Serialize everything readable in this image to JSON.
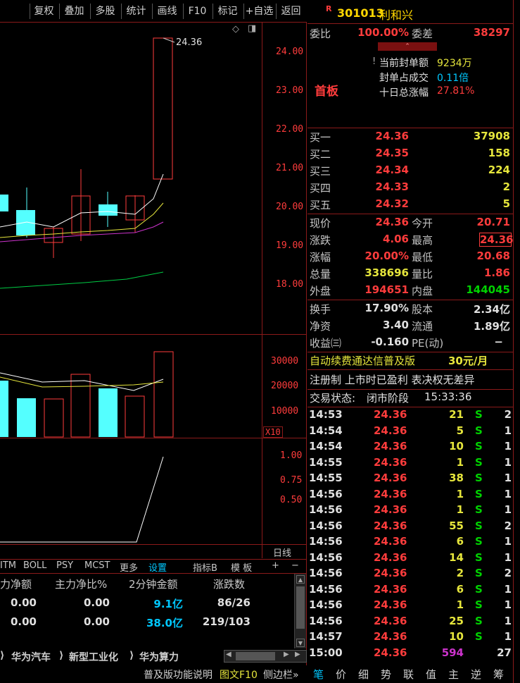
{
  "toolbar": {
    "buttons": [
      "复权",
      "叠加",
      "多股",
      "统计",
      "画线",
      "F10",
      "标记",
      "+自选",
      "返回"
    ]
  },
  "price_axis": [
    "24.00",
    "23.00",
    "22.00",
    "21.00",
    "20.00",
    "19.00",
    "18.00"
  ],
  "price_label": "24.36",
  "volume_axis": [
    "30000",
    "20000",
    "10000"
  ],
  "volume_unit": "X10",
  "osc_axis": [
    "1.00",
    "0.75",
    "0.50"
  ],
  "period_label": "日线",
  "indicator_tabs": [
    "ITM",
    "BOLL",
    "PSY",
    "MCST",
    "更多",
    "设置",
    "指标B",
    "模 板",
    "+",
    "−"
  ],
  "fund_flow": {
    "headers": [
      "力净额",
      "主力净比%",
      "2分钟金额",
      "涨跌数"
    ],
    "rows": [
      [
        "0.00",
        "0.00",
        "9.1亿",
        "86/26"
      ],
      [
        "0.00",
        "0.00",
        "38.0亿",
        "219/103"
      ]
    ]
  },
  "sector_tabs": [
    "华为汽车",
    "新型工业化",
    "华为算力"
  ],
  "status_bar": [
    "普及版功能说明",
    "图文F10",
    "侧边栏»"
  ],
  "stock": {
    "badge": "R",
    "code": "301013",
    "name": "利和兴"
  },
  "wei": {
    "ratio_label": "委比",
    "ratio": "100.00%",
    "diff_label": "委差",
    "diff": "38297"
  },
  "board": {
    "tag": "首板",
    "seal_amount_label": "当前封单额",
    "seal_amount": "9234万",
    "seal_ratio_label": "封单占成交",
    "seal_ratio": "0.11倍",
    "ten_day_label": "十日总涨幅",
    "ten_day": "27.81%"
  },
  "bids": [
    {
      "label": "买一",
      "price": "24.36",
      "vol": "37908"
    },
    {
      "label": "买二",
      "price": "24.35",
      "vol": "158"
    },
    {
      "label": "买三",
      "price": "24.34",
      "vol": "224"
    },
    {
      "label": "买四",
      "price": "24.33",
      "vol": "2"
    },
    {
      "label": "买五",
      "price": "24.32",
      "vol": "5"
    }
  ],
  "quote": {
    "now_label": "现价",
    "now": "24.36",
    "open_label": "今开",
    "open": "20.71",
    "chg_label": "涨跌",
    "chg": "4.06",
    "high_label": "最高",
    "high": "24.36",
    "pct_label": "涨幅",
    "pct": "20.00%",
    "low_label": "最低",
    "low": "20.68",
    "vol_label": "总量",
    "vol": "338696",
    "lb_label": "量比",
    "lb": "1.86",
    "out_label": "外盘",
    "out": "194651",
    "in_label": "内盘",
    "in": "144045"
  },
  "fundamental": {
    "turn_label": "换手",
    "turn": "17.90%",
    "cap_label": "股本",
    "cap": "2.34亿",
    "nav_label": "净资",
    "nav": "3.40",
    "float_label": "流通",
    "float": "1.89亿",
    "eps_label": "收益㈢",
    "eps": "-0.160",
    "pe_label": "PE(动)",
    "pe": "−"
  },
  "promo": {
    "text": "自动续费通达信普及版",
    "price": "30元/月"
  },
  "tags_line": "注册制 上市时已盈利 表决权无差异",
  "trade_state": {
    "label": "交易状态:",
    "state": "闭市阶段",
    "time": "15:33:36"
  },
  "ticks": [
    {
      "t": "14:53",
      "p": "24.36",
      "v": "21",
      "s": "S",
      "n": "2"
    },
    {
      "t": "14:54",
      "p": "24.36",
      "v": "5",
      "s": "S",
      "n": "1"
    },
    {
      "t": "14:54",
      "p": "24.36",
      "v": "10",
      "s": "S",
      "n": "1"
    },
    {
      "t": "14:55",
      "p": "24.36",
      "v": "1",
      "s": "S",
      "n": "1"
    },
    {
      "t": "14:55",
      "p": "24.36",
      "v": "38",
      "s": "S",
      "n": "1"
    },
    {
      "t": "14:56",
      "p": "24.36",
      "v": "1",
      "s": "S",
      "n": "1"
    },
    {
      "t": "14:56",
      "p": "24.36",
      "v": "1",
      "s": "S",
      "n": "1"
    },
    {
      "t": "14:56",
      "p": "24.36",
      "v": "55",
      "s": "S",
      "n": "2"
    },
    {
      "t": "14:56",
      "p": "24.36",
      "v": "6",
      "s": "S",
      "n": "1"
    },
    {
      "t": "14:56",
      "p": "24.36",
      "v": "14",
      "s": "S",
      "n": "1"
    },
    {
      "t": "14:56",
      "p": "24.36",
      "v": "2",
      "s": "S",
      "n": "2"
    },
    {
      "t": "14:56",
      "p": "24.36",
      "v": "6",
      "s": "S",
      "n": "1"
    },
    {
      "t": "14:56",
      "p": "24.36",
      "v": "1",
      "s": "S",
      "n": "1"
    },
    {
      "t": "14:56",
      "p": "24.36",
      "v": "25",
      "s": "S",
      "n": "1"
    },
    {
      "t": "14:57",
      "p": "24.36",
      "v": "10",
      "s": "S",
      "n": "1"
    },
    {
      "t": "15:00",
      "p": "24.36",
      "v": "594",
      "s": "",
      "n": "27"
    }
  ],
  "panel_tabs": [
    "笔",
    "价",
    "细",
    "势",
    "联",
    "值",
    "主",
    "逆",
    "筹"
  ],
  "colors": {
    "up": "#ff3c3c",
    "down": "#54ffff",
    "border": "#8b1a1a",
    "ma5": "#ffffff",
    "ma10": "#e6e63c",
    "ma20": "#cc33cc",
    "ma60": "#00cc44"
  }
}
